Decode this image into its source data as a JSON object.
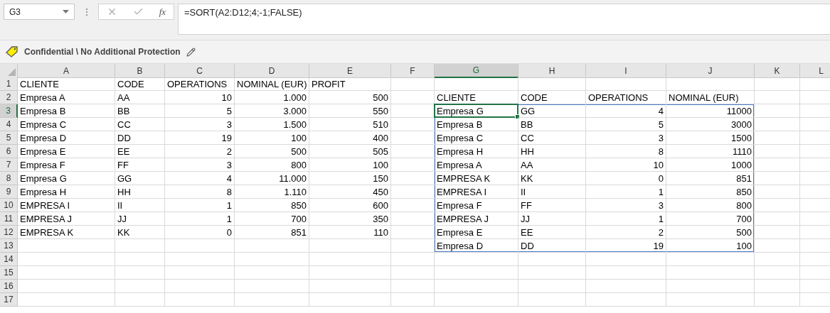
{
  "formula_bar": {
    "name_box": "G3",
    "fx": "fx",
    "formula": "=SORT(A2:D12;4;-1;FALSE)"
  },
  "sensitivity_label": {
    "text": "Confidential \\ No Additional Protection"
  },
  "columns": [
    {
      "label": "A",
      "selected": false
    },
    {
      "label": "B",
      "selected": false
    },
    {
      "label": "C",
      "selected": false
    },
    {
      "label": "D",
      "selected": false
    },
    {
      "label": "E",
      "selected": false
    },
    {
      "label": "F",
      "selected": false
    },
    {
      "label": "G",
      "selected": true
    },
    {
      "label": "H",
      "selected": false
    },
    {
      "label": "I",
      "selected": false
    },
    {
      "label": "J",
      "selected": false
    },
    {
      "label": "K",
      "selected": false
    },
    {
      "label": "L",
      "selected": false
    }
  ],
  "rows": [
    {
      "number": "1",
      "selected": false,
      "cells": [
        {
          "text": "CLIENTE",
          "kind": "text"
        },
        {
          "text": "CODE",
          "kind": "text"
        },
        {
          "text": "OPERATIONS",
          "kind": "text"
        },
        {
          "text": "NOMINAL (EUR)",
          "kind": "text"
        },
        {
          "text": "PROFIT",
          "kind": "text"
        },
        null,
        null,
        null,
        null,
        null,
        null,
        null
      ]
    },
    {
      "number": "2",
      "selected": false,
      "cells": [
        {
          "text": "Empresa A",
          "kind": "text"
        },
        {
          "text": "AA",
          "kind": "text"
        },
        {
          "text": "10",
          "kind": "number"
        },
        {
          "text": "1.000",
          "kind": "number"
        },
        {
          "text": "500",
          "kind": "number"
        },
        null,
        {
          "text": "CLIENTE",
          "kind": "text"
        },
        {
          "text": "CODE",
          "kind": "text"
        },
        {
          "text": "OPERATIONS",
          "kind": "text"
        },
        {
          "text": "NOMINAL (EUR)",
          "kind": "text"
        },
        null,
        null
      ]
    },
    {
      "number": "3",
      "selected": true,
      "cells": [
        {
          "text": "Empresa B",
          "kind": "text"
        },
        {
          "text": "BB",
          "kind": "text"
        },
        {
          "text": "5",
          "kind": "number"
        },
        {
          "text": "3.000",
          "kind": "number"
        },
        {
          "text": "550",
          "kind": "number"
        },
        null,
        {
          "text": "Empresa G",
          "kind": "text",
          "spill": true,
          "active": true
        },
        {
          "text": "GG",
          "kind": "text",
          "spill": true
        },
        {
          "text": "4",
          "kind": "number",
          "spill": true
        },
        {
          "text": "11000",
          "kind": "number",
          "spill": true
        },
        null,
        null
      ]
    },
    {
      "number": "4",
      "selected": false,
      "cells": [
        {
          "text": "Empresa C",
          "kind": "text"
        },
        {
          "text": "CC",
          "kind": "text"
        },
        {
          "text": "3",
          "kind": "number"
        },
        {
          "text": "1.500",
          "kind": "number"
        },
        {
          "text": "510",
          "kind": "number"
        },
        null,
        {
          "text": "Empresa B",
          "kind": "text",
          "spill": true
        },
        {
          "text": "BB",
          "kind": "text",
          "spill": true
        },
        {
          "text": "5",
          "kind": "number",
          "spill": true
        },
        {
          "text": "3000",
          "kind": "number",
          "spill": true
        },
        null,
        null
      ]
    },
    {
      "number": "5",
      "selected": false,
      "cells": [
        {
          "text": "Empresa D",
          "kind": "text"
        },
        {
          "text": "DD",
          "kind": "text"
        },
        {
          "text": "19",
          "kind": "number"
        },
        {
          "text": "100",
          "kind": "number"
        },
        {
          "text": "400",
          "kind": "number"
        },
        null,
        {
          "text": "Empresa C",
          "kind": "text",
          "spill": true
        },
        {
          "text": "CC",
          "kind": "text",
          "spill": true
        },
        {
          "text": "3",
          "kind": "number",
          "spill": true
        },
        {
          "text": "1500",
          "kind": "number",
          "spill": true
        },
        null,
        null
      ]
    },
    {
      "number": "6",
      "selected": false,
      "cells": [
        {
          "text": "Empresa E",
          "kind": "text"
        },
        {
          "text": "EE",
          "kind": "text"
        },
        {
          "text": "2",
          "kind": "number"
        },
        {
          "text": "500",
          "kind": "number"
        },
        {
          "text": "505",
          "kind": "number"
        },
        null,
        {
          "text": "Empresa H",
          "kind": "text",
          "spill": true
        },
        {
          "text": "HH",
          "kind": "text",
          "spill": true
        },
        {
          "text": "8",
          "kind": "number",
          "spill": true
        },
        {
          "text": "1110",
          "kind": "number",
          "spill": true
        },
        null,
        null
      ]
    },
    {
      "number": "7",
      "selected": false,
      "cells": [
        {
          "text": "Empresa F",
          "kind": "text"
        },
        {
          "text": "FF",
          "kind": "text"
        },
        {
          "text": "3",
          "kind": "number"
        },
        {
          "text": "800",
          "kind": "number"
        },
        {
          "text": "100",
          "kind": "number"
        },
        null,
        {
          "text": "Empresa A",
          "kind": "text",
          "spill": true
        },
        {
          "text": "AA",
          "kind": "text",
          "spill": true
        },
        {
          "text": "10",
          "kind": "number",
          "spill": true
        },
        {
          "text": "1000",
          "kind": "number",
          "spill": true
        },
        null,
        null
      ]
    },
    {
      "number": "8",
      "selected": false,
      "cells": [
        {
          "text": "Empresa G",
          "kind": "text"
        },
        {
          "text": "GG",
          "kind": "text"
        },
        {
          "text": "4",
          "kind": "number"
        },
        {
          "text": "11.000",
          "kind": "number"
        },
        {
          "text": "150",
          "kind": "number"
        },
        null,
        {
          "text": "EMPRESA K",
          "kind": "text",
          "spill": true
        },
        {
          "text": "KK",
          "kind": "text",
          "spill": true
        },
        {
          "text": "0",
          "kind": "number",
          "spill": true
        },
        {
          "text": "851",
          "kind": "number",
          "spill": true
        },
        null,
        null
      ]
    },
    {
      "number": "9",
      "selected": false,
      "cells": [
        {
          "text": "Empresa H",
          "kind": "text"
        },
        {
          "text": "HH",
          "kind": "text"
        },
        {
          "text": "8",
          "kind": "number"
        },
        {
          "text": "1.110",
          "kind": "number"
        },
        {
          "text": "450",
          "kind": "number"
        },
        null,
        {
          "text": "EMPRESA I",
          "kind": "text",
          "spill": true
        },
        {
          "text": "II",
          "kind": "text",
          "spill": true
        },
        {
          "text": "1",
          "kind": "number",
          "spill": true
        },
        {
          "text": "850",
          "kind": "number",
          "spill": true
        },
        null,
        null
      ]
    },
    {
      "number": "10",
      "selected": false,
      "cells": [
        {
          "text": "EMPRESA I",
          "kind": "text"
        },
        {
          "text": "II",
          "kind": "text"
        },
        {
          "text": "1",
          "kind": "number"
        },
        {
          "text": "850",
          "kind": "number"
        },
        {
          "text": "600",
          "kind": "number"
        },
        null,
        {
          "text": "Empresa F",
          "kind": "text",
          "spill": true
        },
        {
          "text": "FF",
          "kind": "text",
          "spill": true
        },
        {
          "text": "3",
          "kind": "number",
          "spill": true
        },
        {
          "text": "800",
          "kind": "number",
          "spill": true
        },
        null,
        null
      ]
    },
    {
      "number": "11",
      "selected": false,
      "cells": [
        {
          "text": "EMPRESA J",
          "kind": "text"
        },
        {
          "text": "JJ",
          "kind": "text"
        },
        {
          "text": "1",
          "kind": "number"
        },
        {
          "text": "700",
          "kind": "number"
        },
        {
          "text": "350",
          "kind": "number"
        },
        null,
        {
          "text": "EMPRESA J",
          "kind": "text",
          "spill": true
        },
        {
          "text": "JJ",
          "kind": "text",
          "spill": true
        },
        {
          "text": "1",
          "kind": "number",
          "spill": true
        },
        {
          "text": "700",
          "kind": "number",
          "spill": true
        },
        null,
        null
      ]
    },
    {
      "number": "12",
      "selected": false,
      "cells": [
        {
          "text": "EMPRESA K",
          "kind": "text"
        },
        {
          "text": "KK",
          "kind": "text"
        },
        {
          "text": "0",
          "kind": "number"
        },
        {
          "text": "851",
          "kind": "number"
        },
        {
          "text": "110",
          "kind": "number"
        },
        null,
        {
          "text": "Empresa E",
          "kind": "text",
          "spill": true
        },
        {
          "text": "EE",
          "kind": "text",
          "spill": true
        },
        {
          "text": "2",
          "kind": "number",
          "spill": true
        },
        {
          "text": "500",
          "kind": "number",
          "spill": true
        },
        null,
        null
      ]
    },
    {
      "number": "13",
      "selected": false,
      "cells": [
        null,
        null,
        null,
        null,
        null,
        null,
        {
          "text": "Empresa D",
          "kind": "text",
          "spill": true
        },
        {
          "text": "DD",
          "kind": "text",
          "spill": true
        },
        {
          "text": "19",
          "kind": "number",
          "spill": true
        },
        {
          "text": "100",
          "kind": "number",
          "spill": true
        },
        null,
        null
      ]
    },
    {
      "number": "14",
      "selected": false,
      "cells": [
        null,
        null,
        null,
        null,
        null,
        null,
        null,
        null,
        null,
        null,
        null,
        null
      ]
    },
    {
      "number": "15",
      "selected": false,
      "cells": [
        null,
        null,
        null,
        null,
        null,
        null,
        null,
        null,
        null,
        null,
        null,
        null
      ]
    },
    {
      "number": "16",
      "selected": false,
      "cells": [
        null,
        null,
        null,
        null,
        null,
        null,
        null,
        null,
        null,
        null,
        null,
        null
      ]
    },
    {
      "number": "17",
      "selected": false,
      "cells": [
        null,
        null,
        null,
        null,
        null,
        null,
        null,
        null,
        null,
        null,
        null,
        null
      ]
    }
  ]
}
